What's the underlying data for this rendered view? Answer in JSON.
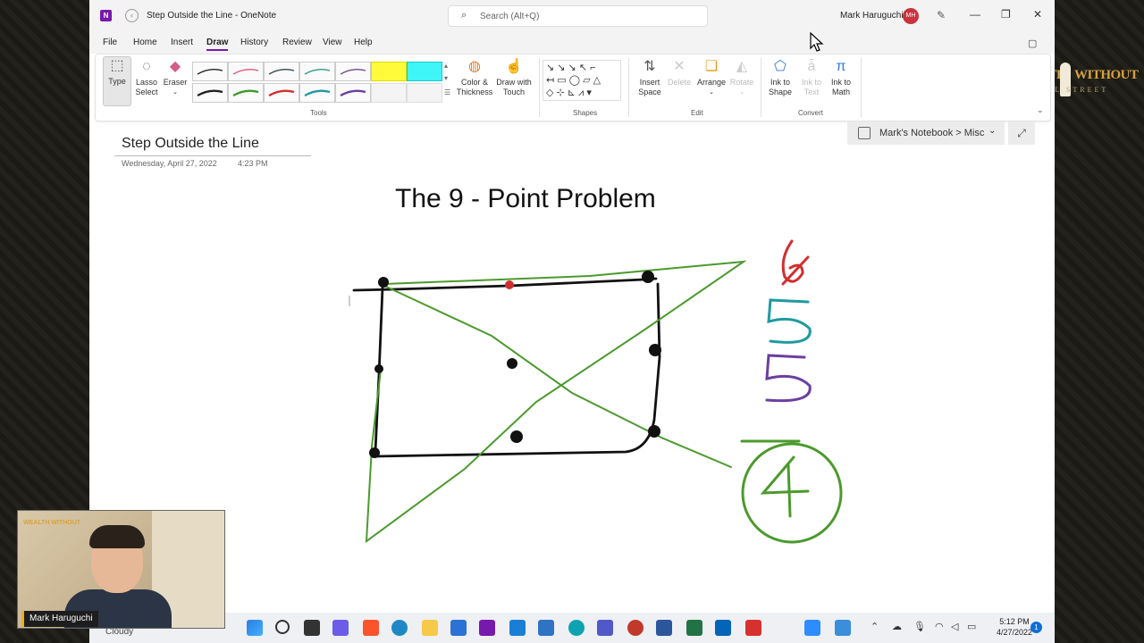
{
  "titlebar": {
    "doc_title": "Step Outside the Line  -  OneNote",
    "search_placeholder": "Search (Alt+Q)",
    "user_name": "Mark Haruguchi",
    "user_initials": "MH"
  },
  "menu": [
    "File",
    "Home",
    "Insert",
    "Draw",
    "History",
    "Review",
    "View",
    "Help"
  ],
  "active_menu": "Draw",
  "ribbon": {
    "tools": {
      "type": "Type",
      "lasso": "Lasso\nSelect",
      "eraser": "Eraser",
      "color_thickness": "Color &\nThickness",
      "draw_touch": "Draw with\nTouch"
    },
    "edit": {
      "insert_space": "Insert\nSpace",
      "delete": "Delete",
      "arrange": "Arrange",
      "rotate": "Rotate"
    },
    "convert": {
      "ink_to_shape": "Ink to\nShape",
      "ink_to_text": "Ink to\nText",
      "ink_to_math": "Ink to\nMath"
    },
    "groups": [
      "Tools",
      "Shapes",
      "Edit",
      "Convert"
    ],
    "pen_colors": [
      "#222222",
      "#e05a77",
      "#2e4a4f",
      "#2a9a8a",
      "#6a4c8c",
      "#222222",
      "#3d9a2a",
      "#d12f2f",
      "#1f9a9f",
      "#6b3fa0"
    ]
  },
  "page": {
    "title": "Step Outside the Line",
    "date": "Wednesday, April 27, 2022",
    "time": "4:23 PM",
    "notebook_path": "Mark's Notebook > Misc",
    "heading": "The 9 - Point Problem"
  },
  "taskbar": {
    "weather": "Cloudy",
    "time": "5:12 PM",
    "date": "4/27/2022",
    "notification_count": "1"
  },
  "webcam": {
    "name_tag": "Mark Haruguchi",
    "logo": "WEALTH WITHOUT"
  },
  "brand": {
    "word1": "WEALTH",
    "word2": "WITHOUT",
    "word3": "WALL STREET"
  }
}
